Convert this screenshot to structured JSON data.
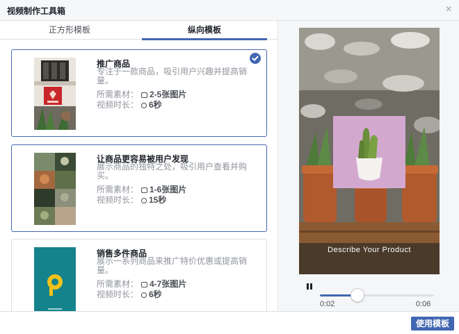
{
  "window": {
    "title": "视频制作工具箱",
    "close_icon": "close-icon"
  },
  "tabs": [
    {
      "label": "正方形模板",
      "active": false
    },
    {
      "label": "纵向模板",
      "active": true
    }
  ],
  "cards": [
    {
      "title": "推广商品",
      "description": "专注于一款商品，吸引用户兴趣并提高销量。",
      "materials_label": "所需素材：",
      "materials_value": "2-5张图片",
      "duration_label": "视频时长：",
      "duration_value": "6秒",
      "selected": true
    },
    {
      "title": "让商品更容易被用户发现",
      "description": "展示商品的独特之处，吸引用户查看并购买。",
      "materials_label": "所需素材：",
      "materials_value": "1-6张图片",
      "duration_label": "视频时长：",
      "duration_value": "15秒",
      "selected": false
    },
    {
      "title": "销售多件商品",
      "description": "展示一系列商品来推广特价优惠或提高销量。",
      "materials_label": "所需素材：",
      "materials_value": "4-7张图片",
      "duration_label": "视频时长：",
      "duration_value": "6秒",
      "selected": false
    }
  ],
  "preview": {
    "overlay_text": "Describe Your Product",
    "progress_fraction": 0.33,
    "time_current": "0:02",
    "time_total": "0:06"
  },
  "footer": {
    "use_button": "使用模板"
  },
  "colors": {
    "accent": "#4267b2",
    "border": "#dddfe2",
    "muted": "#90949c"
  }
}
